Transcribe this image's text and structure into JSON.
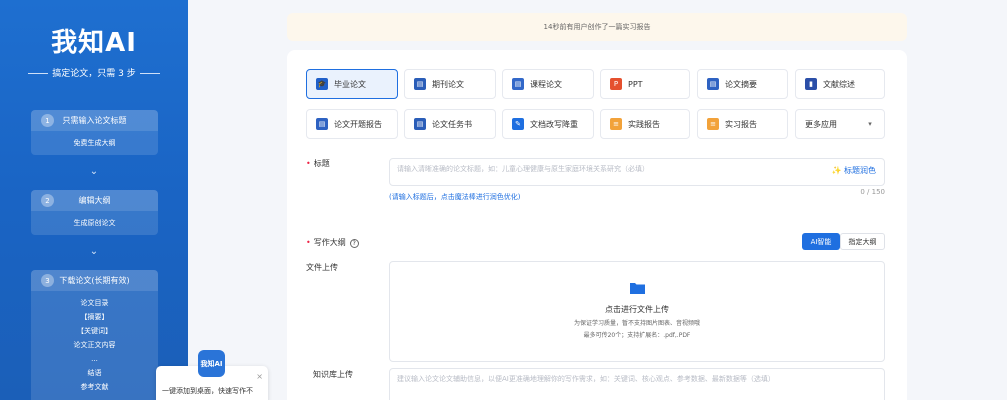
{
  "sidebar": {
    "logo": "我知AI",
    "tagline_prefix": "搞定论文，只需 ",
    "tagline_num": "3",
    "tagline_suffix": " 步",
    "steps": [
      {
        "num": "1",
        "title": "只需输入论文标题",
        "items": [
          "免费生成大纲"
        ]
      },
      {
        "num": "2",
        "title": "编辑大纲",
        "items": [
          "生成原创论文"
        ]
      },
      {
        "num": "3",
        "title": "下载论文(长期有效)",
        "items": [
          "论文目录",
          "【摘要】",
          "【关键词】",
          "论文正文内容",
          "...",
          "结语",
          "参考文献"
        ]
      }
    ],
    "arrow": "⌄"
  },
  "notice": "14秒前有用户创作了一篇实习报告",
  "types": [
    {
      "label": "毕业论文",
      "icon": "graduation-cap-icon",
      "color": "#1f5fc9",
      "glyph": "🎓"
    },
    {
      "label": "期刊论文",
      "icon": "journal-icon",
      "color": "#2a5db8",
      "glyph": "▤"
    },
    {
      "label": "课程论文",
      "icon": "course-icon",
      "color": "#3268c9",
      "glyph": "▤"
    },
    {
      "label": "PPT",
      "icon": "ppt-icon",
      "color": "#e5502e",
      "glyph": "P"
    },
    {
      "label": "论文摘要",
      "icon": "abstract-icon",
      "color": "#2e62c2",
      "glyph": "▤"
    },
    {
      "label": "文献综述",
      "icon": "review-icon",
      "color": "#2b4fa8",
      "glyph": "▮"
    },
    {
      "label": "论文开题报告",
      "icon": "proposal-icon",
      "color": "#2e62c2",
      "glyph": "▤"
    },
    {
      "label": "论文任务书",
      "icon": "task-book-icon",
      "color": "#2a5db8",
      "glyph": "▤"
    },
    {
      "label": "文档改写降重",
      "icon": "rewrite-icon",
      "color": "#1f6fe0",
      "glyph": "✎"
    },
    {
      "label": "实践报告",
      "icon": "practice-report-icon",
      "color": "#f2a23a",
      "glyph": "≡"
    },
    {
      "label": "实习报告",
      "icon": "internship-report-icon",
      "color": "#f2a23a",
      "glyph": "≡"
    },
    {
      "label": "更多应用",
      "icon": "chevron-down-icon",
      "color": "#666666",
      "glyph": "▾"
    }
  ],
  "form": {
    "title_label": "标题",
    "title_placeholder": "请输入清晰准确的论文标题，如：儿童心理健康与原生家庭环境关系研究（必填）",
    "polish_label": "标题润色",
    "counter": "0 / 150",
    "hint": "(请输入标题后，点击魔法棒进行润色优化)",
    "outline_label": "写作大纲",
    "toggle_ai": "AI智能",
    "toggle_custom": "指定大纲",
    "upload_label": "文件上传",
    "upload_main": "点击进行文件上传",
    "upload_sub1": "为保证学习质量，暂不支持图片图表、音视频哦",
    "upload_sub2": "最多可传20个；支持扩展名：.pdf,.PDF",
    "kb_label": "知识库上传",
    "kb_placeholder": "建议输入论文论文辅助信息，以便AI更准确地理解你的写作需求，如：关键词、核心观点、参考数据、最新数据等（选填）"
  },
  "floating": {
    "icon_text": "我知AI",
    "popup_text": "一键添加到桌面，快速写作不",
    "close": "×"
  }
}
